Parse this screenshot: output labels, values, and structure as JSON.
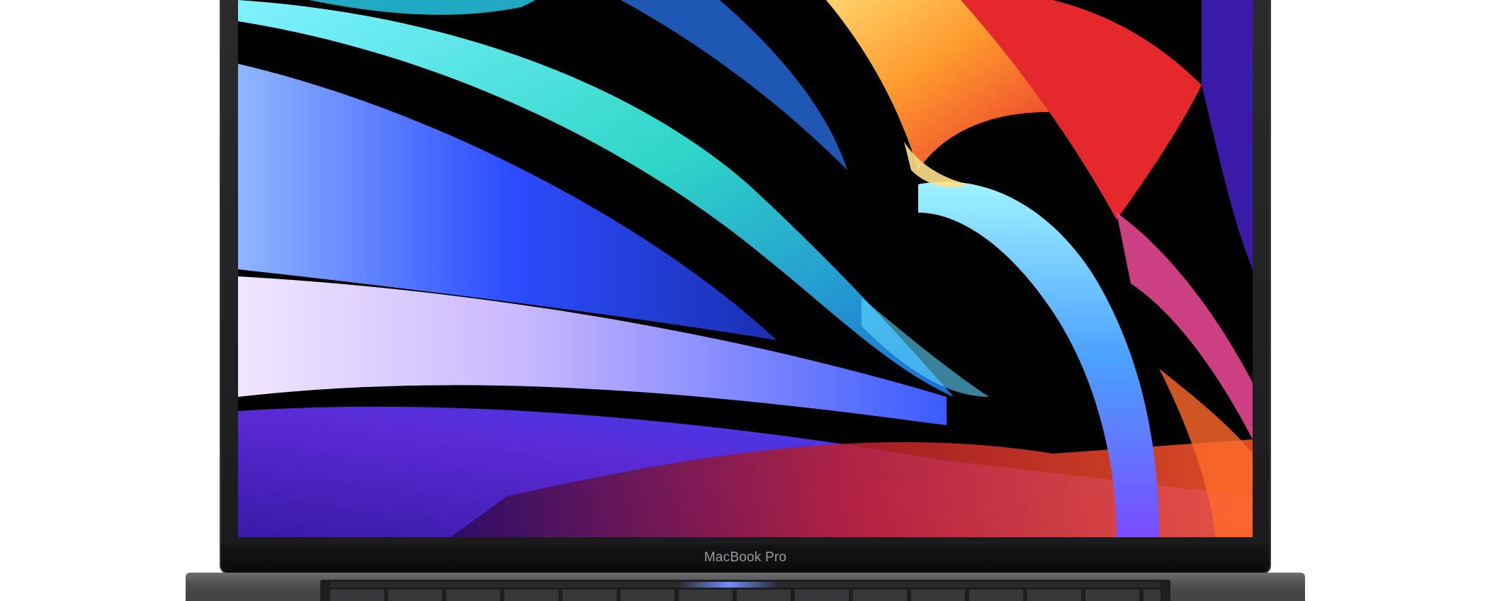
{
  "device": {
    "brand_label": "MacBook Pro"
  },
  "wallpaper": {
    "description_colors": {
      "background": "#000000",
      "violet": "#5b2bd6",
      "blue": "#2c4dff",
      "cyan": "#2fd6c8",
      "orange": "#ff9a2e",
      "red": "#e4282c",
      "pink": "#ff4fa0",
      "lavender": "#c9b8ff"
    }
  },
  "body_colors": {
    "lid": "#2b2b2e",
    "chin": "#141416",
    "base": "#6c6c70",
    "touch_bar_accent": "#6f8fff"
  }
}
